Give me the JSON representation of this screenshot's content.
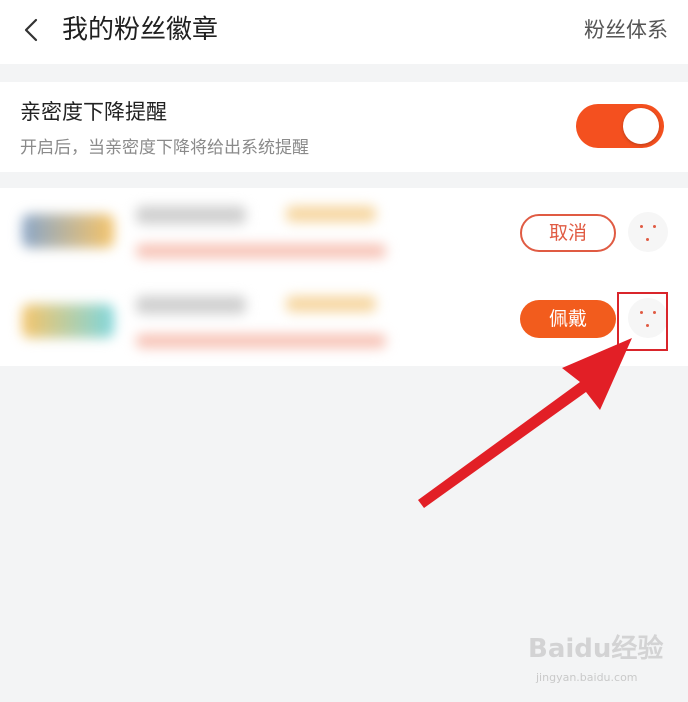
{
  "header": {
    "title": "我的粉丝徽章",
    "right_link": "粉丝体系",
    "back_icon": "chevron-left-icon"
  },
  "reminder": {
    "title": "亲密度下降提醒",
    "description": "开启后，当亲密度下降将给出系统提醒",
    "toggle_on": true,
    "toggle_color": "#f4501f"
  },
  "badges": [
    {
      "action_label": "取消",
      "action_style": "outline",
      "badge_color": "#f5c46a"
    },
    {
      "action_label": "佩戴",
      "action_style": "filled",
      "badge_color": "#7fd6dc"
    }
  ],
  "annotation": {
    "arrow_color": "#e21f26"
  },
  "watermark": {
    "brand": "Baidu经验",
    "url": "jingyan.baidu.com"
  }
}
